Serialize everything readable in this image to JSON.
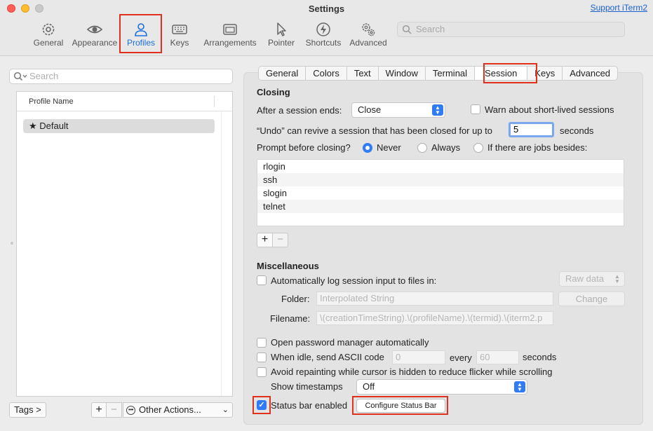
{
  "window": {
    "title": "Settings",
    "support_link": "Support iTerm2"
  },
  "toolbar": {
    "items": [
      {
        "label": "General",
        "icon": "gear-icon"
      },
      {
        "label": "Appearance",
        "icon": "eye-icon"
      },
      {
        "label": "Profiles",
        "icon": "person-icon",
        "active": true
      },
      {
        "label": "Keys",
        "icon": "keyboard-icon"
      },
      {
        "label": "Arrangements",
        "icon": "windows-icon"
      },
      {
        "label": "Pointer",
        "icon": "pointer-icon"
      },
      {
        "label": "Shortcuts",
        "icon": "bolt-icon"
      },
      {
        "label": "Advanced",
        "icon": "gears-icon"
      }
    ],
    "search_placeholder": "Search"
  },
  "sidebar": {
    "search_placeholder": "Search",
    "column_header": "Profile Name",
    "profiles": [
      {
        "name": "Default",
        "starred": true
      }
    ],
    "tags_button": "Tags >",
    "add_button": "+",
    "remove_button": "−",
    "other_actions": "Other Actions..."
  },
  "tabs": {
    "items": [
      "General",
      "Colors",
      "Text",
      "Window",
      "Terminal",
      "Session",
      "Keys",
      "Advanced"
    ],
    "selected": "Session"
  },
  "session": {
    "closing_heading": "Closing",
    "after_session_label": "After a session ends:",
    "after_session_value": "Close",
    "warn_short_lived": "Warn about short-lived sessions",
    "undo_label": "“Undo” can revive a session that has been closed for up to",
    "undo_value": "5",
    "undo_unit": "seconds",
    "prompt_label": "Prompt before closing?",
    "prompt_never": "Never",
    "prompt_always": "Always",
    "prompt_jobs": "If there are jobs besides:",
    "jobs": [
      "rlogin",
      "ssh",
      "slogin",
      "telnet"
    ],
    "jobs_add": "+",
    "jobs_remove": "−"
  },
  "misc": {
    "heading": "Miscellaneous",
    "auto_log_label": "Automatically log session input to files in:",
    "log_format": "Raw data",
    "folder_label": "Folder:",
    "folder_placeholder": "Interpolated String",
    "change_button": "Change",
    "filename_label": "Filename:",
    "filename_value": "\\(creationTimeString).\\(profileName).\\(termid).\\(iterm2.p",
    "password_manager": "Open password manager automatically",
    "idle_label": "When idle, send ASCII code",
    "idle_code": "0",
    "idle_every": "every",
    "idle_seconds_value": "60",
    "idle_seconds": "seconds",
    "avoid_repaint": "Avoid repainting while cursor is hidden to reduce flicker while scrolling",
    "timestamps_label": "Show timestamps",
    "timestamps_value": "Off",
    "status_bar_label": "Status bar enabled",
    "status_bar_checked": true,
    "configure_status_bar": "Configure Status Bar"
  },
  "colors": {
    "accent": "#2f7cf6",
    "highlight": "#e0301e"
  }
}
